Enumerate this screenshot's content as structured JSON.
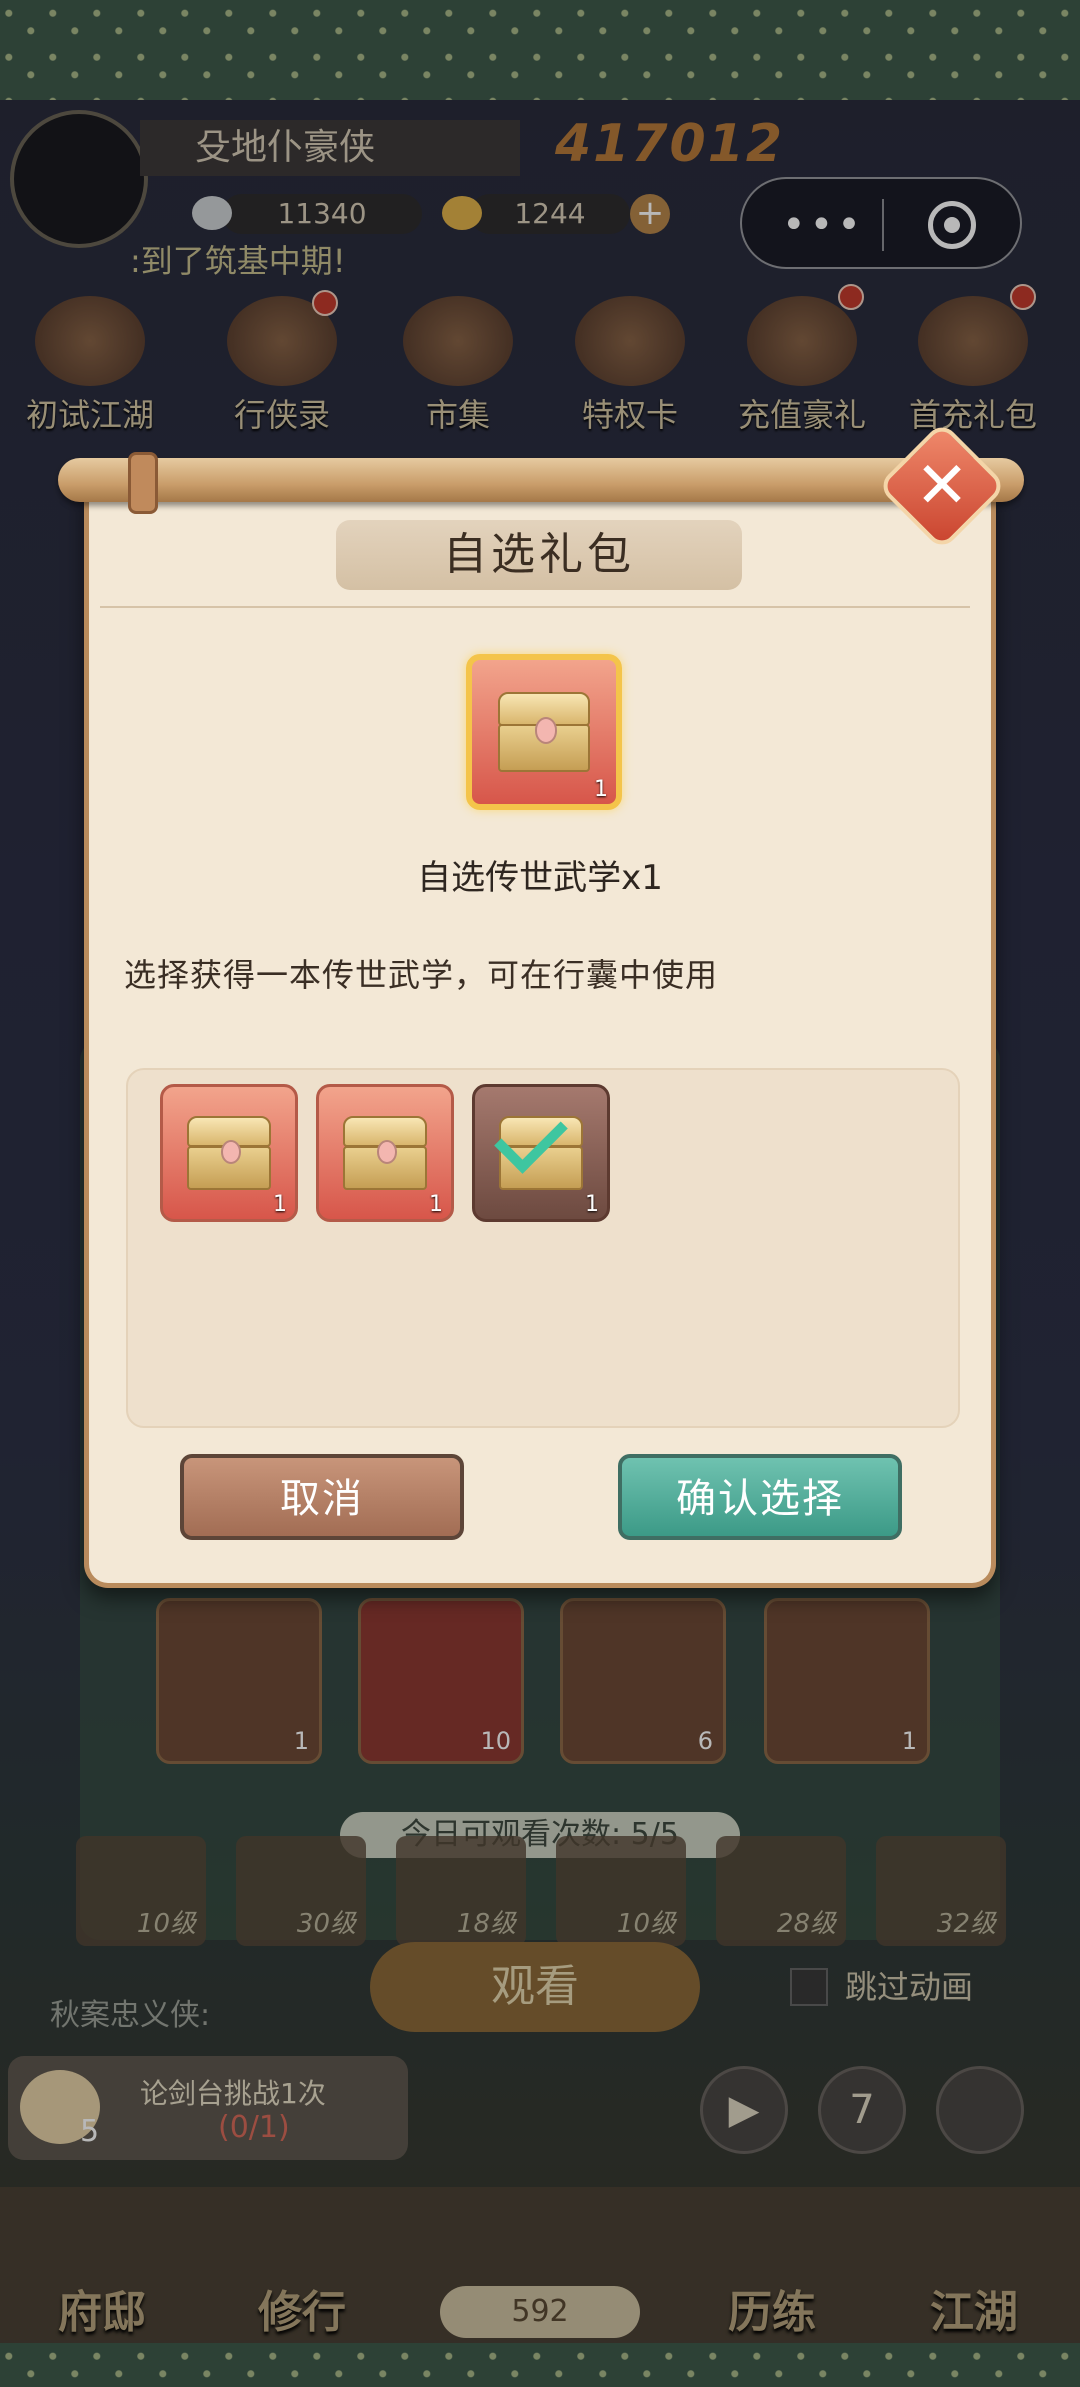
{
  "header": {
    "player_name": "殳地仆豪侠",
    "power": "417012",
    "silver": "11340",
    "gold": "1244",
    "plus": "+",
    "news": ":到了筑基中期!"
  },
  "capsule": {
    "more": "•••"
  },
  "activities": [
    {
      "label": "初试江湖"
    },
    {
      "label": "行侠录"
    },
    {
      "label": "市集"
    },
    {
      "label": "特权卡"
    },
    {
      "label": "充值豪礼"
    },
    {
      "label": "首充礼包"
    }
  ],
  "background": {
    "rewards": [
      {
        "qty": "1"
      },
      {
        "qty": "10"
      },
      {
        "qty": "6"
      },
      {
        "qty": "1"
      }
    ],
    "watch_count": "今日可观看次数: 5/5",
    "levels": [
      "10级",
      "30级",
      "18级",
      "10级",
      "28级",
      "32级"
    ],
    "watch_button": "观看",
    "skip_label": "跳过动画",
    "chat": "秋案忠义侠:",
    "task_title": "论剑台挑战1次",
    "task_progress": "(0/1)",
    "task_count": "5",
    "play": "▶",
    "seven": "7",
    "bun_count": "592",
    "nav": [
      "府邸",
      "修行",
      "历练",
      "江湖"
    ]
  },
  "dialog": {
    "title": "自选礼包",
    "close": "✕",
    "gift_qty": "1",
    "item_name": "自选传世武学x1",
    "description": "选择获得一本传世武学，可在行囊中使用",
    "options": [
      {
        "qty": "1",
        "selected": false
      },
      {
        "qty": "1",
        "selected": false
      },
      {
        "qty": "1",
        "selected": true
      }
    ],
    "cancel": "取消",
    "confirm": "确认选择"
  }
}
